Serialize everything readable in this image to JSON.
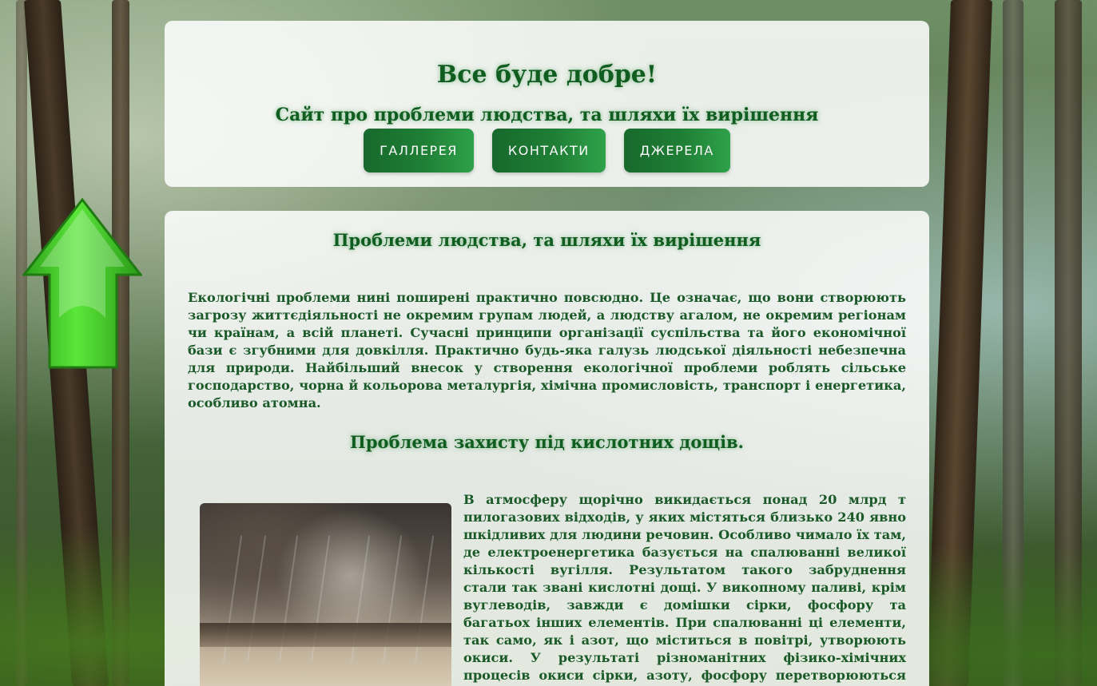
{
  "header": {
    "title": "Все буде добре!",
    "subtitle": "Сайт про проблеми людства, та шляхи їх вирішення"
  },
  "nav": {
    "items": [
      {
        "label": "ГАЛЛЕРЕЯ"
      },
      {
        "label": "КОНТАКТИ"
      },
      {
        "label": "ДЖЕРЕЛА"
      }
    ]
  },
  "main": {
    "section1": {
      "title": "Проблеми людства, та шляхи їх вирішення",
      "text": "Екологічні проблеми нині поширені практично повсюдно. Це означає, що вони створюють загрозу життєдіяльності не окремим групам людей, а людству агалом, не окремим регіонам чи країнам, а всій планеті. Сучасні принципи організації суспільства та його економічної бази є згубними для довкілля. Практично будь-яка галузь людської діяльності небезпечна для природи. Найбільший внесок у створення екологічної проблеми роблять сільське господарство, чорна й кольорова металургія, хімічна промисловість, транспорт і енергетика, особливо атомна."
    },
    "section2": {
      "title": "Проблема захисту під кислотних дощів.",
      "text": "В атмосферу щорічно викидається понад 20 млрд т пилогазових відходів, у яких містяться близько 240 явно шкідливих для людини речовин. Особливо чимало їх там, де електроенергетика базується на спалюванні великої кількості вугілля. Результатом такого забруднення стали так звані кислотні дощі. У викопному паливі, крім вуглеводів, завжди є домішки сірки, фосфору та багатьох інших елементів. При спалюванні ці елементи, так само, як і азот, що міститься в повітрі, утворюють окиси. У результаті різноманітних фізико-хімічних процесів окиси сірки, азоту, фосфору перетворюються на кислоти, які разом з атмосферними опадами потрапляють на поверхню землі."
    }
  },
  "colors": {
    "heading": "#0f5d1f",
    "text": "#1a5a28",
    "button": "#1f7f35",
    "arrow": "#3fcf2a"
  },
  "icons": {
    "scroll_top": "up-arrow-icon"
  }
}
